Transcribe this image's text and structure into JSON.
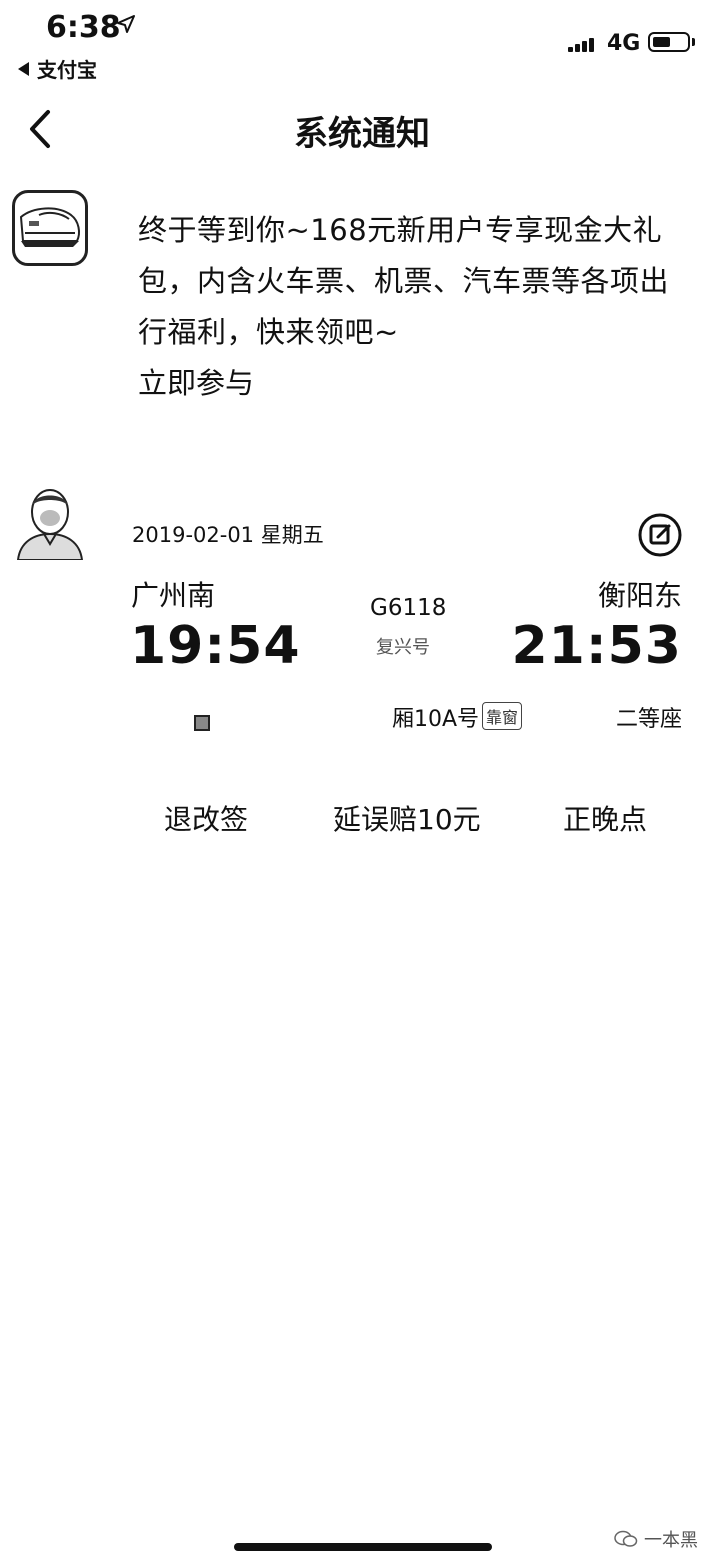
{
  "status_bar": {
    "time": "6:38",
    "back_app": "支付宝",
    "network": "4G"
  },
  "nav": {
    "title": "系统通知"
  },
  "notifications": [
    {
      "icon": "train-app-icon",
      "text": "终于等到你~168元新用户专享现金大礼包，内含火车票、机票、汽车票等各项出行福利，快来领吧~",
      "link": "立即参与"
    }
  ],
  "ticket": {
    "date": "2019-02-01 星期五",
    "from_station": "广州南",
    "to_station": "衡阳东",
    "train_no": "G6118",
    "train_type": "复兴号",
    "departure_time": "19:54",
    "arrival_time": "21:53",
    "seat_no": "厢10A号",
    "seat_badge": "靠窗",
    "seat_class": "二等座",
    "actions": {
      "change": "退改签",
      "delay": "延误赔10元",
      "punctual": "正晚点"
    }
  },
  "watermark": {
    "text": "一本黑"
  }
}
